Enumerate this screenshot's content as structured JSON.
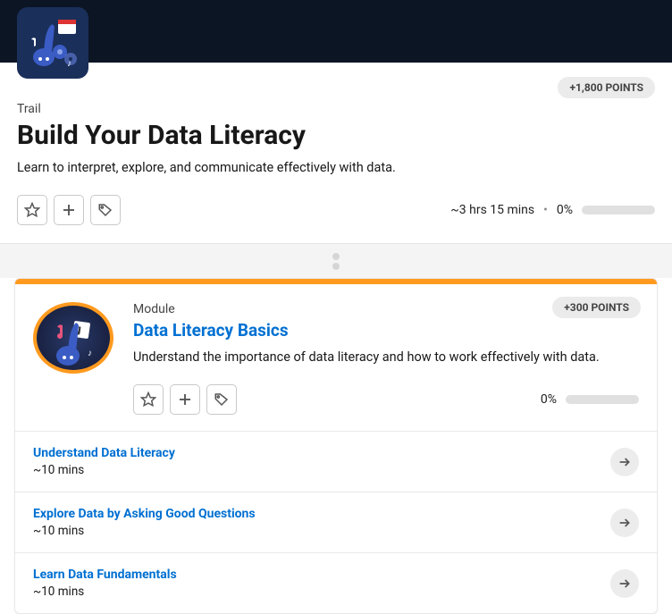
{
  "trail": {
    "category": "Trail",
    "title": "Build Your Data Literacy",
    "subtitle": "Learn to interpret, explore, and communicate effectively with data.",
    "points": "+1,800 POINTS",
    "duration": "~3 hrs 15 mins",
    "separator": "•",
    "percent": "0%"
  },
  "module": {
    "label": "Module",
    "title": "Data Literacy Basics",
    "desc": "Understand the importance of data literacy and how to work effectively with data.",
    "points": "+300 POINTS",
    "percent": "0%"
  },
  "lessons": [
    {
      "title": "Understand Data Literacy",
      "time": "~10 mins"
    },
    {
      "title": "Explore Data by Asking Good Questions",
      "time": "~10 mins"
    },
    {
      "title": "Learn Data Fundamentals",
      "time": "~10 mins"
    }
  ]
}
